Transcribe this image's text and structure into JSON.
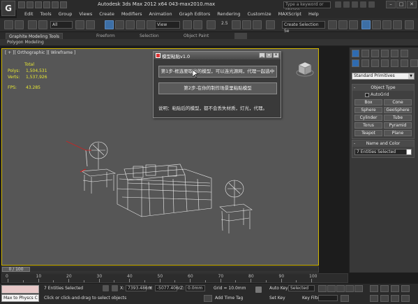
{
  "app": {
    "logo_letter": "G",
    "window_title": "Autodesk 3ds Max  2012 x64      043-max2010.max",
    "search_placeholder": "Type a keyword or phrase"
  },
  "menu": {
    "items": [
      "Edit",
      "Tools",
      "Group",
      "Views",
      "Create",
      "Modifiers",
      "Animation",
      "Graph Editors",
      "Rendering",
      "Customize",
      "MAXScript",
      "Help"
    ]
  },
  "toolbar": {
    "selection_filter": "All",
    "view_dropdown": "View",
    "snap_value": "2.5",
    "selection_set_placeholder": "Create Selection Se"
  },
  "ribbon": {
    "tabs": [
      "Graphite Modeling Tools",
      "Freeform",
      "Selection",
      "Object Paint"
    ],
    "sub_label": "Polygon Modeling"
  },
  "viewport": {
    "label": "[ + ][ Orthographic ][ Wireframe ]",
    "stats": {
      "total_label": "Total",
      "polys_label": "Polys:",
      "polys_value": "1,504,531",
      "verts_label": "Verts:",
      "verts_value": "1,537,926",
      "fps_label": "FPS:",
      "fps_value": "43.285"
    },
    "highlight_color": "#d2b700"
  },
  "dialog": {
    "title": "模型粘贴v1.0",
    "step1": "第1步-框选要取出的模型，可以连光源网，代理一起选中",
    "step2": "第2步-在你的制作场景里粘贴模型",
    "note": "说明：粘贴后的模型，都不会丢失材质，灯光，代理。"
  },
  "command_panel": {
    "dropdown": "Standard Primitives",
    "object_type_title": "Object Type",
    "autogrid_label": "AutoGrid",
    "object_buttons": [
      "Box",
      "Cone",
      "Sphere",
      "GeoSphere",
      "Cylinder",
      "Tube",
      "Torus",
      "Pyramid",
      "Teapot",
      "Plane"
    ],
    "name_color_title": "Name and Color",
    "name_value": "7 Entities Selected"
  },
  "timeline": {
    "frame_label": "0 / 100",
    "ticks": [
      "0",
      "10",
      "20",
      "30",
      "40",
      "50",
      "60",
      "70",
      "80",
      "90",
      "100"
    ]
  },
  "status": {
    "maxscript_text": "Max to Physcs C",
    "selected_text": "7 Entities Selected",
    "prompt_text": "Click or click-and-drag to select objects",
    "x_label": "X:",
    "x_value": "7393.486m",
    "y_label": "Y:",
    "y_value": "-5077.406r",
    "z_label": "Z:",
    "z_value": "0.0mm",
    "grid_text": "Grid = 10.0mm",
    "add_time_tag": "Add Time Tag",
    "auto_key": "Auto Key",
    "set_key": "Set Key",
    "selected_dropdown": "Selected",
    "key_filters": "Key Filters..."
  }
}
